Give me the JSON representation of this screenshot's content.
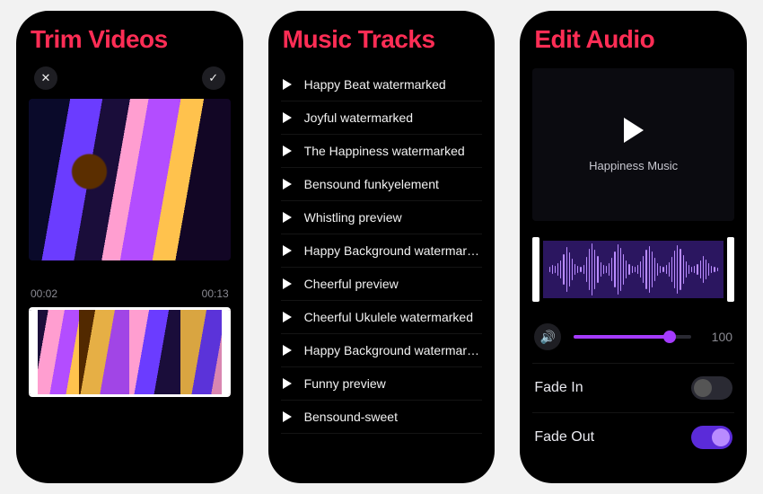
{
  "colors": {
    "accent": "#ff2d55",
    "purple": "#a53bff"
  },
  "panels": {
    "trim": {
      "title": "Trim Videos",
      "time_start": "00:02",
      "time_end": "00:13"
    },
    "music": {
      "title": "Music Tracks",
      "tracks": [
        "Happy Beat watermarked",
        "Joyful watermarked",
        "The Happiness watermarked",
        "Bensound funkyelement",
        "Whistling preview",
        "Happy Background watermarked",
        "Cheerful preview",
        "Cheerful Ukulele watermarked",
        "Happy Background watermarked",
        "Funny preview",
        "Bensound-sweet"
      ]
    },
    "audio": {
      "title": "Edit Audio",
      "clip_name": "Happiness Music",
      "volume_value": "100",
      "fade_in_label": "Fade In",
      "fade_out_label": "Fade Out",
      "fade_in_on": false,
      "fade_out_on": true
    }
  },
  "icons": {
    "close": "✕",
    "check": "✓",
    "speaker": "🔊"
  }
}
